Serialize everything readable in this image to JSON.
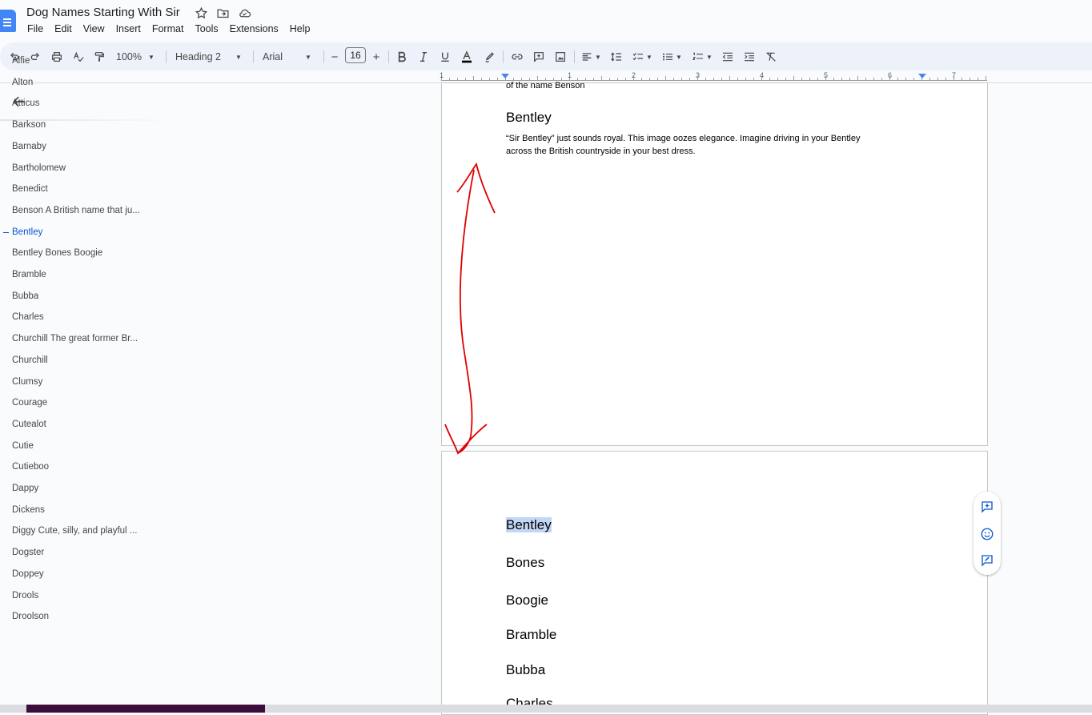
{
  "app": {
    "title": "Dog Names Starting With Sir",
    "menu": [
      "File",
      "Edit",
      "View",
      "Insert",
      "Format",
      "Tools",
      "Extensions",
      "Help"
    ]
  },
  "toolbar": {
    "zoom": "100%",
    "style": "Heading 2",
    "font": "Arial",
    "font_size": "16",
    "minus": "−",
    "plus": "+"
  },
  "ruler": {
    "numbers": [
      "1",
      "1",
      "2",
      "3",
      "4",
      "5",
      "6",
      "7"
    ]
  },
  "outline": {
    "active_index": 8,
    "items": [
      "Alfie",
      "Alton",
      "Atticus",
      "Barkson",
      "Barnaby",
      "Bartholomew",
      "Benedict",
      "Benson A British name that ju...",
      "Bentley",
      "Bentley Bones Boogie",
      "Bramble",
      "Bubba",
      "Charles",
      "Churchill The great former Br...",
      "Churchill",
      "Clumsy",
      "Courage",
      "Cutealot",
      "Cutie",
      "Cutieboo",
      "Dappy",
      "Dickens",
      "Diggy Cute, silly, and playful ...",
      "Dogster",
      "Doppey",
      "Drools",
      "Droolson"
    ]
  },
  "page1": {
    "cut_text": "of the name Benson",
    "heading": "Bentley",
    "paragraph_line1": "“Sir Bentley” just sounds royal. This image oozes elegance. Imagine driving in your Bentley",
    "paragraph_line2": "across the British countryside in your best dress."
  },
  "page2": {
    "headings": [
      "Bentley",
      "Bones",
      "Boogie",
      "Bramble",
      "Bubba",
      "Charles"
    ]
  },
  "colors": {
    "accent": "#0b57d0",
    "doc_icon": "#4285f4",
    "toolbar_bg": "#edf2fa",
    "annotation": "#e00000",
    "selection": "#c2d6f5"
  }
}
